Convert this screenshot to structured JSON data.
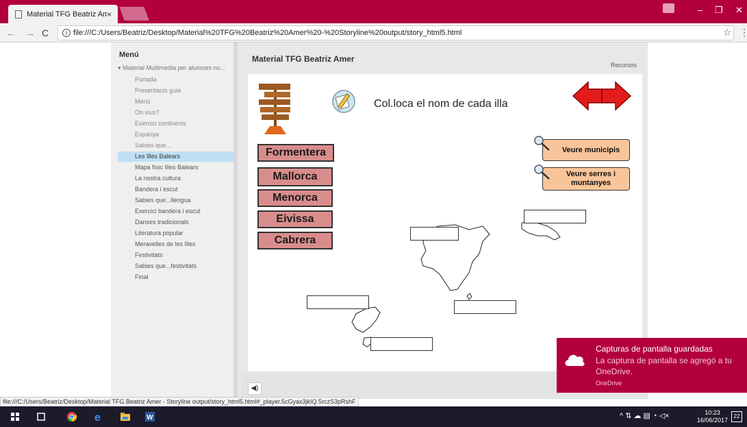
{
  "browser": {
    "tab_title": "Material TFG Beatriz Ame",
    "tab_close": "×",
    "url": "file:///C:/Users/Beatriz/Desktop/Material%20TFG%20Beatriz%20Amer%20-%20Storyline%20output/story_html5.html",
    "status_url": "file:///C:/Users/Beatriz/Desktop/Material TFG Beatriz Amer - Storyline output/story_html5.html#_player.5cGyax3jkIQ.5rczS3pRshF"
  },
  "sidebar": {
    "heading": "Menú",
    "root": "Material Multimedia per alumnes no...",
    "items": [
      {
        "label": "Portada"
      },
      {
        "label": "Presentació guia"
      },
      {
        "label": "Menú"
      },
      {
        "label": "On vius?"
      },
      {
        "label": "Exercici continents"
      },
      {
        "label": "Espanya"
      },
      {
        "label": "Sabies que..."
      },
      {
        "label": "Les Illes Balears"
      },
      {
        "label": "Mapa físic Illes Balears"
      },
      {
        "label": "La nostra cultura"
      },
      {
        "label": "Bandera i escut"
      },
      {
        "label": "Sabies que...llengua"
      },
      {
        "label": "Exercici bandera i escut"
      },
      {
        "label": "Danses tradicionals"
      },
      {
        "label": "Literatura popular"
      },
      {
        "label": "Meravelles de les Illes"
      },
      {
        "label": "Festivitats"
      },
      {
        "label": "Sabies que...festivitats"
      },
      {
        "label": "Final"
      }
    ]
  },
  "player": {
    "title": "Material TFG Beatriz Amer",
    "resources": "Recursos"
  },
  "slide": {
    "instruction": "Col.loca el nom de cada illa",
    "islands": [
      "Formentera",
      "Mallorca",
      "Menorca",
      "Eivissa",
      "Cabrera"
    ],
    "buttons": {
      "municipis": "Veure municipis",
      "serres_1": "Veure serres i",
      "serres_2": "muntanyes"
    }
  },
  "toast": {
    "title": "Capturas de pantalla guardadas",
    "body": "La captura de pantalla se agregó a tu OneDrive.",
    "source": "OneDrive"
  },
  "taskbar": {
    "time": "10:23",
    "date": "16/06/2017",
    "notif_count": "22"
  },
  "colors": {
    "chrome_accent": "#b3003c",
    "island_button": "#d98c8c",
    "info_button": "#f8c59a",
    "arrow_red": "#e31b1b"
  }
}
